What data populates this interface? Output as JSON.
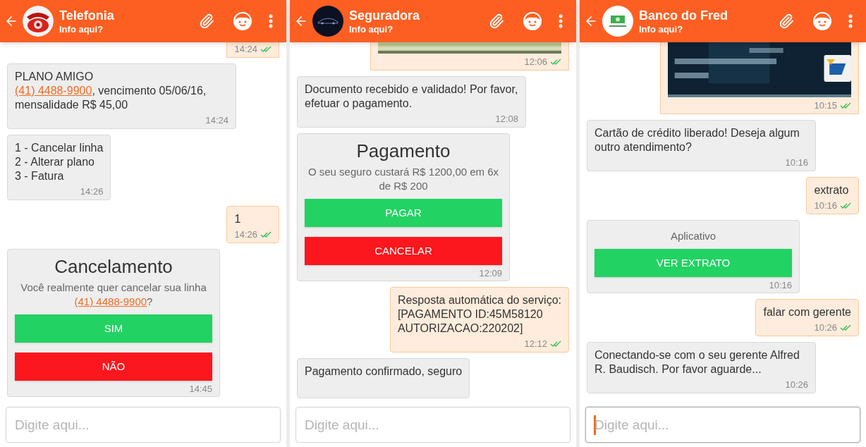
{
  "chats": [
    {
      "contact": {
        "name": "Telefonia",
        "status": "Info aqui?",
        "avatar": {
          "kind": "phone"
        }
      },
      "messages": [
        {
          "kind": "text",
          "outgoing": true,
          "cut_top": true,
          "time": "14:24"
        },
        {
          "kind": "text",
          "outgoing": false,
          "parts": [
            {
              "kind": "text",
              "text": "PLANO AMIGO\n"
            },
            {
              "kind": "link",
              "text": "(41) 4488-9900"
            },
            {
              "kind": "text",
              "text": ", vencimento 05/06/16, mensalidade R$ 45,00"
            }
          ],
          "time": "14:24"
        },
        {
          "kind": "text",
          "outgoing": false,
          "parts": [
            {
              "kind": "text",
              "text": "1 - Cancelar linha\n2 - Alterar plano\n3 - Fatura"
            }
          ],
          "time": "14:26"
        },
        {
          "kind": "text",
          "outgoing": true,
          "parts": [
            {
              "kind": "text",
              "text": "1"
            }
          ],
          "time": "14:26"
        },
        {
          "kind": "card",
          "outgoing": false,
          "title": "Cancelamento",
          "body": [
            {
              "kind": "text",
              "text": "Você realmente quer cancelar sua linha "
            },
            {
              "kind": "link",
              "text": "(41) 4488-9900"
            },
            {
              "kind": "text",
              "text": "?"
            }
          ],
          "buttons": [
            {
              "label": "SIM",
              "kind": "confirm"
            },
            {
              "label": "NÃO",
              "kind": "cancel"
            }
          ],
          "time": "14:45"
        }
      ],
      "input": {
        "placeholder": "Digite aqui...",
        "focused": false
      }
    },
    {
      "contact": {
        "name": "Seguradora",
        "status": "Info aqui?",
        "avatar": {
          "kind": "car"
        }
      },
      "messages": [
        {
          "outgoing": true,
          "cut_top": true,
          "picture": {
            "kind": "grass"
          },
          "time": "12:06"
        },
        {
          "kind": "text",
          "outgoing": false,
          "parts": [
            {
              "kind": "text",
              "text": "Documento recebido e validado! Por favor, efetuar o pagamento."
            }
          ],
          "time": "12:08"
        },
        {
          "kind": "card",
          "outgoing": false,
          "title": "Pagamento",
          "body": [
            {
              "kind": "text",
              "text": "O seu seguro custará R$ 1200,00 em 6x de R$ 200"
            }
          ],
          "buttons": [
            {
              "label": "PAGAR",
              "kind": "confirm"
            },
            {
              "label": "CANCELAR",
              "kind": "cancel"
            }
          ],
          "time": "12:09"
        },
        {
          "kind": "text",
          "outgoing": true,
          "parts": [
            {
              "kind": "text",
              "text": "Resposta automática do serviço:\n[PAGAMENTO ID:45M58120\nAUTORIZACAO:220202]"
            }
          ],
          "time": "12:12"
        },
        {
          "kind": "text",
          "outgoing": false,
          "parts": [
            {
              "kind": "text",
              "text": "Pagamento confirmado, seguro"
            }
          ]
        }
      ],
      "input": {
        "placeholder": "Digite aqui...",
        "focused": false
      }
    },
    {
      "contact": {
        "name": "Banco do Fred",
        "status": "Info aqui?",
        "avatar": {
          "kind": "money"
        }
      },
      "messages": [
        {
          "outgoing": true,
          "cut_top": true,
          "picture": {
            "kind": "card"
          },
          "time": "10:15"
        },
        {
          "kind": "text",
          "outgoing": false,
          "parts": [
            {
              "kind": "text",
              "text": "Cartão de crédito liberado! Deseja algum outro atendimento?"
            }
          ],
          "time": "10:16"
        },
        {
          "kind": "text",
          "outgoing": true,
          "parts": [
            {
              "kind": "text",
              "text": "extrato"
            }
          ],
          "time": "10:16"
        },
        {
          "kind": "card",
          "outgoing": false,
          "body": [
            {
              "kind": "text",
              "text": "Aplicativo"
            }
          ],
          "buttons": [
            {
              "label": "VER EXTRATO",
              "kind": "confirm"
            }
          ],
          "time": "10:16"
        },
        {
          "kind": "text",
          "outgoing": true,
          "parts": [
            {
              "kind": "text",
              "text": "falar com gerente"
            }
          ],
          "time": "10:26"
        },
        {
          "kind": "text",
          "outgoing": false,
          "parts": [
            {
              "kind": "text",
              "text": "Conectando-se com o seu gerente Alfred R. Baudisch. Por favor aguarde..."
            }
          ],
          "time": "10:26"
        }
      ],
      "input": {
        "placeholder": "Digite aqui...",
        "focused": true
      }
    }
  ]
}
